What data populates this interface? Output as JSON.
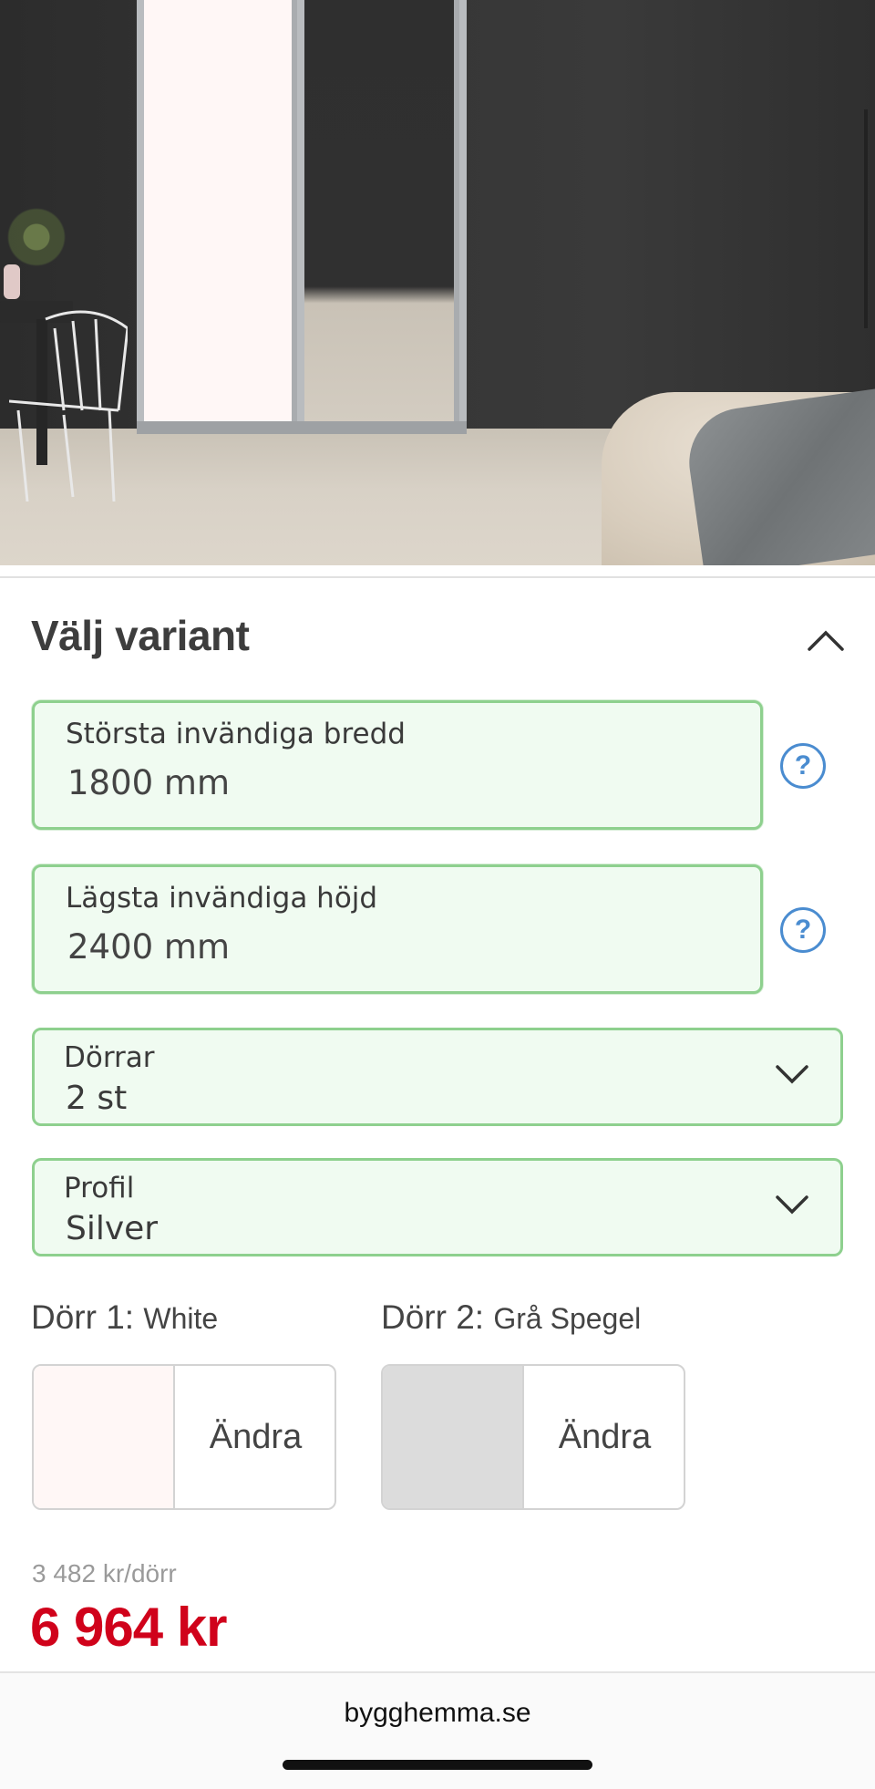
{
  "hero": {
    "image": "wardrobe-sliding-doors-bedroom-photo"
  },
  "variant": {
    "title": "Välj variant",
    "width_field": {
      "label": "Största invändiga bredd",
      "value": "1800 mm"
    },
    "height_field": {
      "label": "Lägsta invändiga höjd",
      "value": "2400 mm"
    },
    "help_glyph": "?",
    "doors_select": {
      "label": "Dörrar",
      "value": "2 st"
    },
    "profile_select": {
      "label": "Profil",
      "value": "Silver"
    }
  },
  "doors": [
    {
      "label": "Dörr 1:",
      "color": "White",
      "swatch": "#fff7f6",
      "change": "Ändra"
    },
    {
      "label": "Dörr 2:",
      "color": "Grå Spegel",
      "swatch": "#dcdcdc",
      "change": "Ändra"
    }
  ],
  "price": {
    "per_door": "3 482 kr/dörr",
    "total": "6 964 kr",
    "total_color": "#d0021b"
  },
  "browser": {
    "domain": "bygghemma.se"
  }
}
